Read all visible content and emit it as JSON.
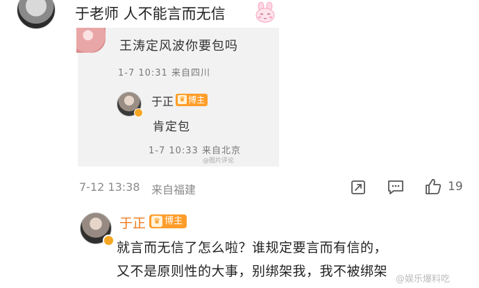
{
  "top_comment": {
    "text": "于老师 人不能言而无信",
    "emoji": "bunny-blush-emoji"
  },
  "quoted_screenshot": {
    "original_comment": "王涛定风波你要包吗",
    "original_meta": "1-7 10:31 来自四川",
    "reply_author": "于正",
    "reply_badge": "博主",
    "reply_text": "肯定包",
    "reply_meta": "1-7 10:33 来自北京",
    "watermark": "@图片评论"
  },
  "comment_meta": {
    "time": "7-12 13:38",
    "location": "来自福建",
    "like_count": "19",
    "icons": [
      "share-icon",
      "comment-icon",
      "like-icon"
    ]
  },
  "blogger_reply": {
    "author": "于正",
    "badge": "博主",
    "line1": "就言而无信了怎么啦？谁规定要言而有信的，",
    "line2": "又不是原则性的大事，别绑架我，我不被绑架"
  },
  "page_watermark": "@娱乐爆料吃",
  "colors": {
    "author_name": "#f07a1e",
    "badge": "#ff9d2a",
    "meta_text": "#8a8a8a"
  }
}
